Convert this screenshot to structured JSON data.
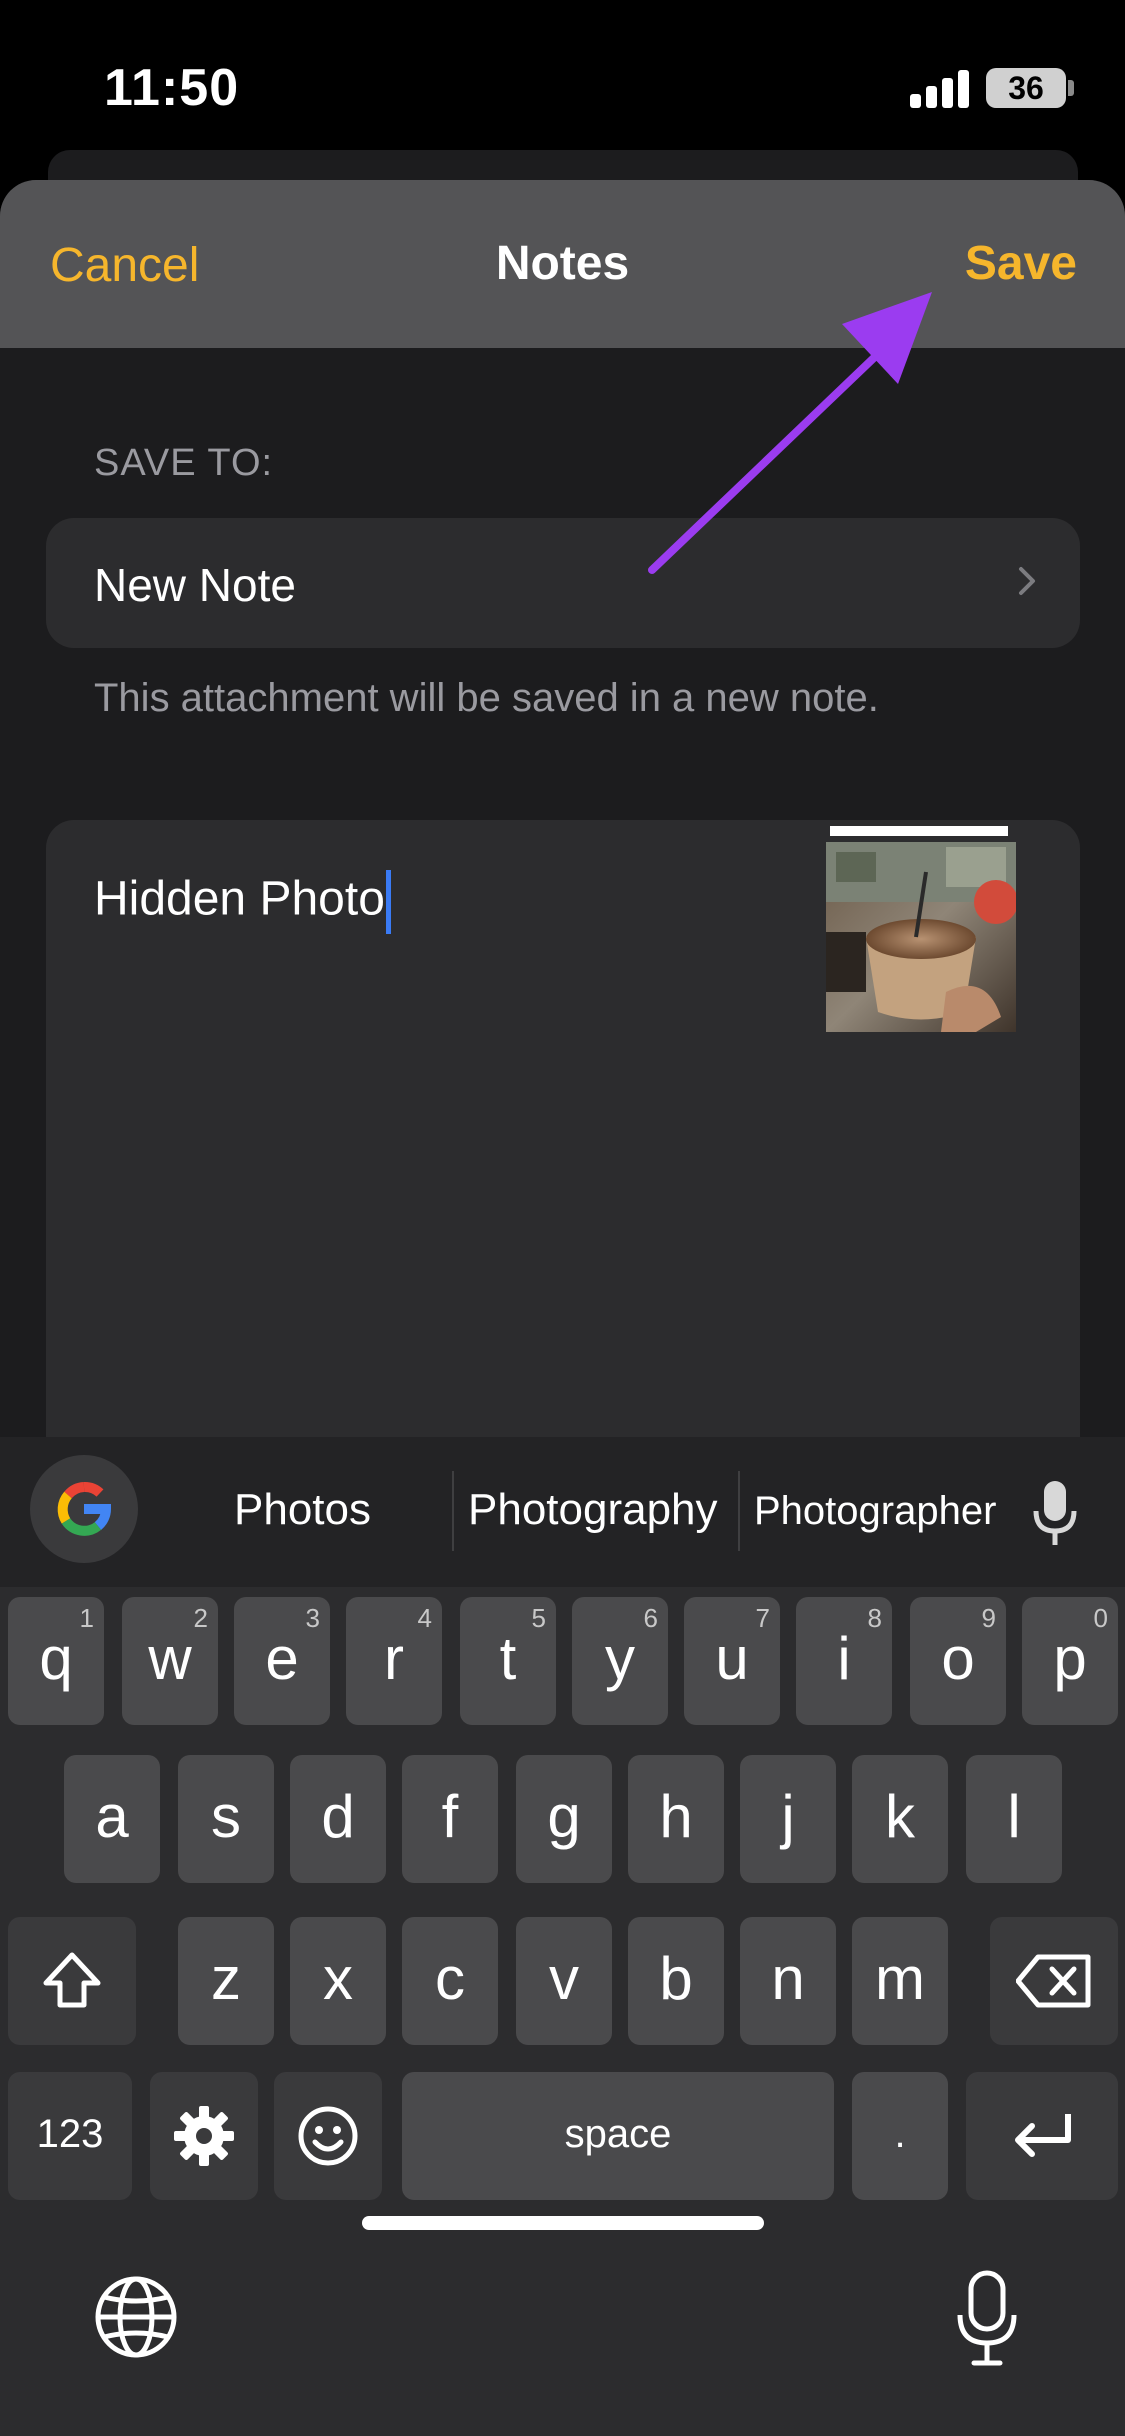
{
  "status_bar": {
    "time": "11:50",
    "battery": "36"
  },
  "nav": {
    "cancel": "Cancel",
    "title": "Notes",
    "save": "Save"
  },
  "save_to": {
    "section_label": "SAVE TO:",
    "destination": "New Note",
    "caption": "This attachment will be saved in a new note."
  },
  "note": {
    "text": "Hidden Photo"
  },
  "suggestions": [
    "Photos",
    "Photography",
    "Photographer"
  ],
  "keyboard": {
    "row1": [
      {
        "k": "q",
        "n": "1"
      },
      {
        "k": "w",
        "n": "2"
      },
      {
        "k": "e",
        "n": "3"
      },
      {
        "k": "r",
        "n": "4"
      },
      {
        "k": "t",
        "n": "5"
      },
      {
        "k": "y",
        "n": "6"
      },
      {
        "k": "u",
        "n": "7"
      },
      {
        "k": "i",
        "n": "8"
      },
      {
        "k": "o",
        "n": "9"
      },
      {
        "k": "p",
        "n": "0"
      }
    ],
    "row2": [
      "a",
      "s",
      "d",
      "f",
      "g",
      "h",
      "j",
      "k",
      "l"
    ],
    "row3": [
      "z",
      "x",
      "c",
      "v",
      "b",
      "n",
      "m"
    ],
    "numbers_key": "123",
    "space_key": "space",
    "period_key": "."
  },
  "colors": {
    "accent": "#f6b62c",
    "annotation_arrow": "#9b3cf0",
    "cursor": "#3a7bf5"
  }
}
